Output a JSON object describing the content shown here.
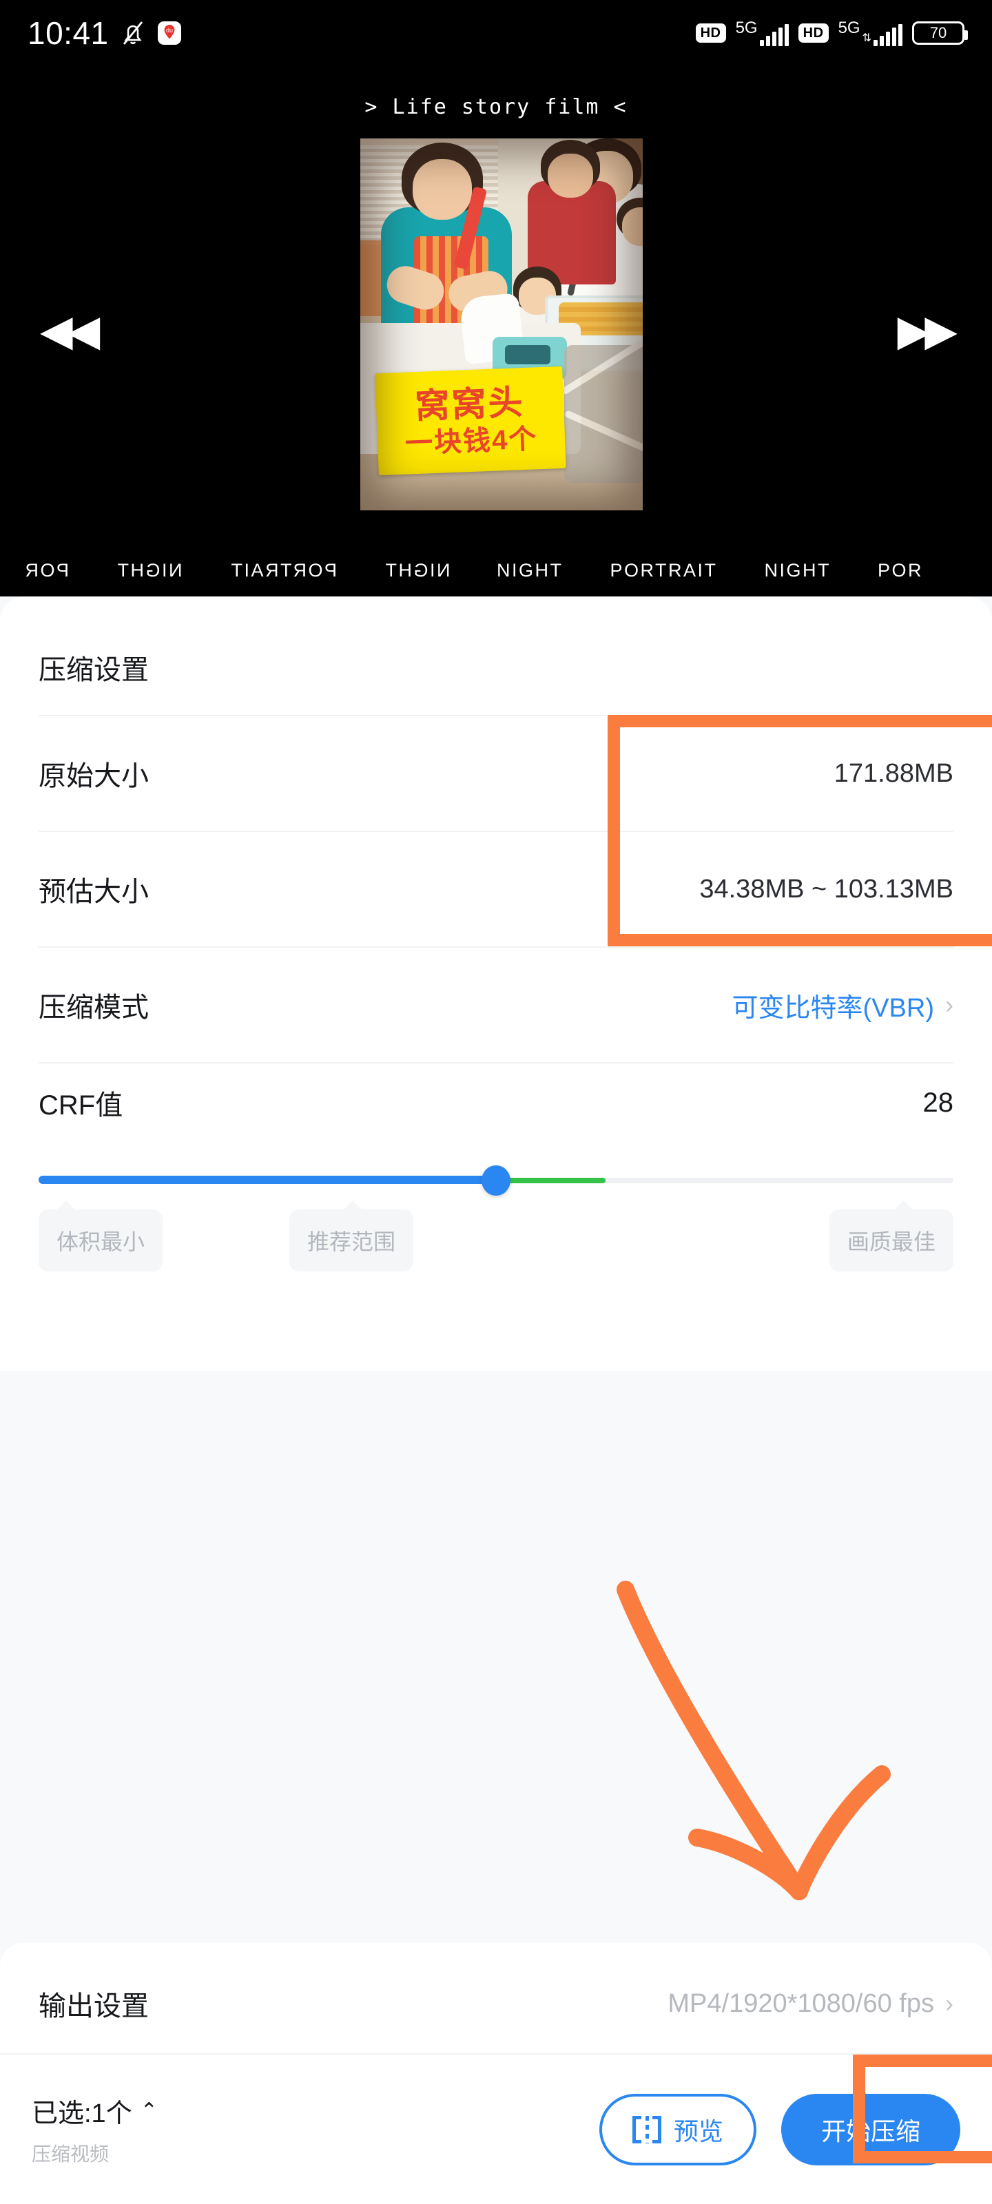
{
  "statusbar": {
    "clock": "10:41",
    "mute_icon": "bell-muted-icon",
    "app_icon_label": "du",
    "hd1": "HD",
    "net1": "5G",
    "hd2": "HD",
    "net2": "5G",
    "battery_level": "70"
  },
  "video": {
    "title": "> Life story film <",
    "prev_icon": "rewind-icon",
    "next_icon": "fast-forward-icon",
    "thumbnail_sign_line1": "窝窝头",
    "thumbnail_sign_line2": "一块钱4个"
  },
  "mode_strip": {
    "items": [
      {
        "label": "POR",
        "mirrored": true
      },
      {
        "label": "NIGHT",
        "mirrored": true
      },
      {
        "label": "PORTRAIT",
        "mirrored": true
      },
      {
        "label": "NIGHT",
        "mirrored": true
      },
      {
        "label": "NIGHT",
        "mirrored": false
      },
      {
        "label": "PORTRAIT",
        "mirrored": false
      },
      {
        "label": "NIGHT",
        "mirrored": false
      },
      {
        "label": "POR",
        "mirrored": false
      }
    ]
  },
  "settings": {
    "title": "压缩设置",
    "rows": [
      {
        "label": "原始大小",
        "value": "171.88MB"
      },
      {
        "label": "预估大小",
        "value": "34.38MB ~ 103.13MB"
      },
      {
        "label": "压缩模式",
        "value": "可变比特率(VBR)"
      }
    ],
    "crf": {
      "label": "CRF值",
      "value": "28",
      "slider_percent": 50,
      "recommended_start_percent": 33,
      "recommended_end_percent": 62,
      "tip_min": "体积最小",
      "tip_recommended": "推荐范围",
      "tip_best": "画质最佳"
    }
  },
  "output": {
    "label": "输出设置",
    "value": "MP4/1920*1080/60 fps"
  },
  "bottom": {
    "selected": "已选:1个",
    "caret": "︿",
    "subtitle": "压缩视频",
    "preview_label": "预览",
    "preview_icon": "compare-split-icon",
    "start_label": "开始压缩"
  },
  "annotations": {
    "accent_color": "#fa7d3f",
    "highlight_size_box": "size-values-highlight",
    "highlight_start_box": "start-button-highlight",
    "arrow": "arrow-pointing-to-start-button"
  },
  "colors": {
    "primary_blue": "#2a86f0",
    "green": "#35c248",
    "orange": "#fa7d3f",
    "sheet_bg": "#f7f9fb"
  }
}
